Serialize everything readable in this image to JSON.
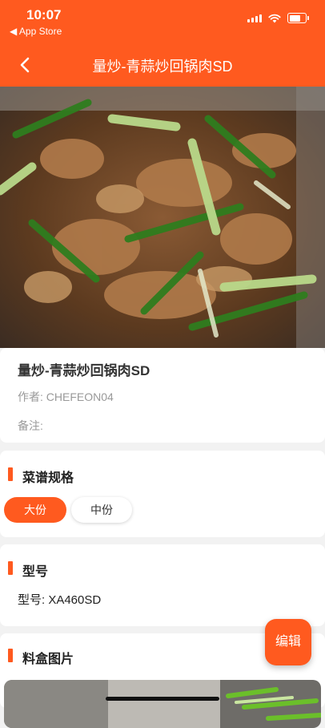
{
  "status_bar": {
    "time": "10:07",
    "back_label": "◀ App Store"
  },
  "nav": {
    "title": "量炒-青蒜炒回锅肉SD",
    "back_icon": "chevron-left-icon"
  },
  "dish": {
    "name": "量炒-青蒜炒回锅肉SD",
    "author": "作者: CHEFEON04",
    "note": "备注:"
  },
  "spec_section": {
    "title": "菜谱规格",
    "options": [
      {
        "label": "大份",
        "selected": true
      },
      {
        "label": "中份",
        "selected": false
      }
    ]
  },
  "model_section": {
    "title": "型号",
    "model": "型号: XA460SD"
  },
  "box_section": {
    "title": "料盒图片"
  },
  "edit_button": {
    "label": "编辑"
  },
  "colors": {
    "accent": "#ff5a1f",
    "background": "#f2f2f2"
  }
}
